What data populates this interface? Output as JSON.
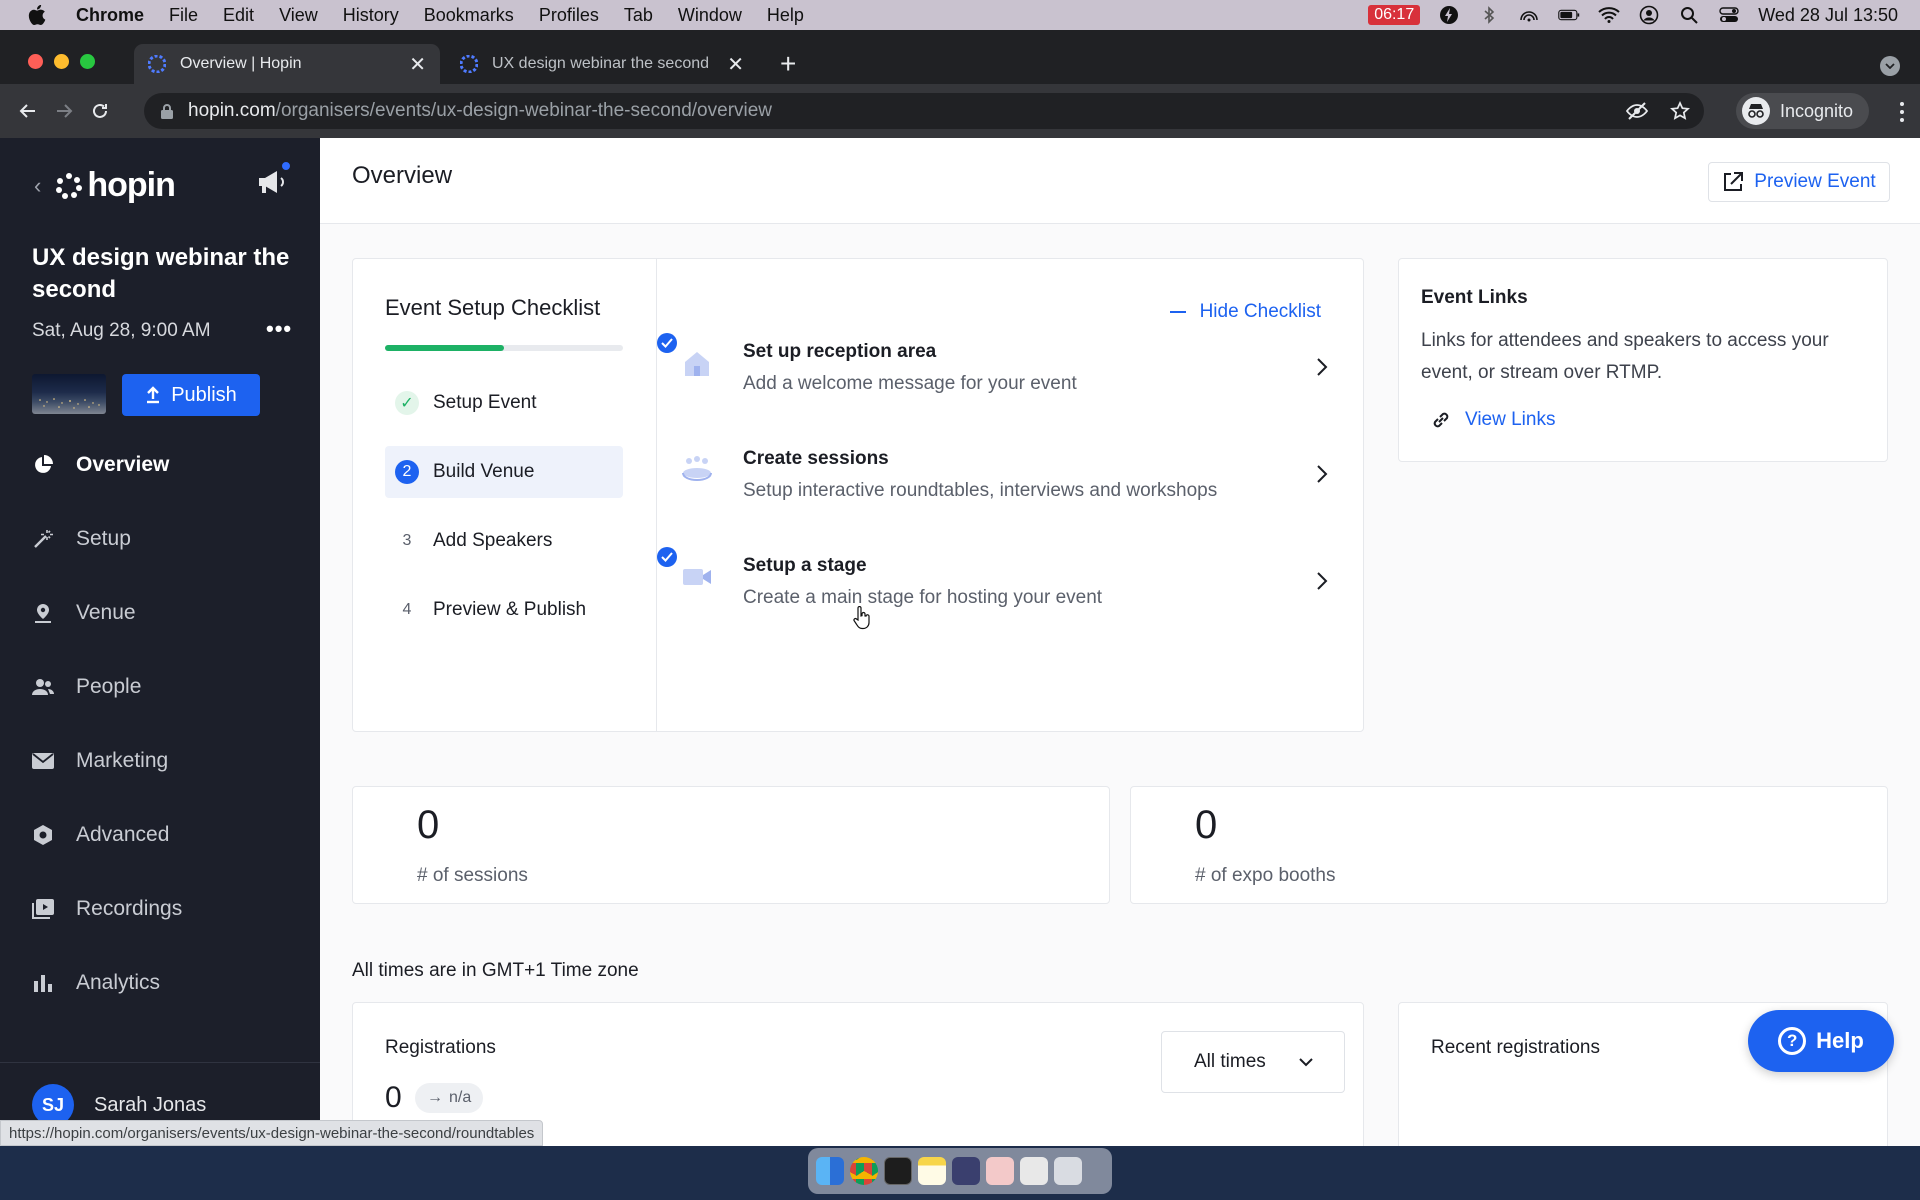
{
  "menubar": {
    "app": "Chrome",
    "items": [
      "File",
      "Edit",
      "View",
      "History",
      "Bookmarks",
      "Profiles",
      "Tab",
      "Window",
      "Help"
    ],
    "battery_time": "06:17",
    "datetime": "Wed 28 Jul  13:50"
  },
  "browser": {
    "tabs": [
      {
        "title": "Overview | Hopin"
      },
      {
        "title": "UX design webinar the second"
      }
    ],
    "url_host": "hopin.com",
    "url_path": "/organisers/events/ux-design-webinar-the-second/overview",
    "profile": "Incognito",
    "status_url": "https://hopin.com/organisers/events/ux-design-webinar-the-second/roundtables"
  },
  "sidebar": {
    "logo": "hopin",
    "event_title": "UX design webinar the second",
    "event_date": "Sat, Aug 28, 9:00 AM",
    "more": "•••",
    "publish_label": "Publish",
    "nav": [
      {
        "label": "Overview",
        "icon": "pie-chart-icon"
      },
      {
        "label": "Setup",
        "icon": "magic-wand-icon"
      },
      {
        "label": "Venue",
        "icon": "venue-pin-icon"
      },
      {
        "label": "People",
        "icon": "people-icon"
      },
      {
        "label": "Marketing",
        "icon": "envelope-icon"
      },
      {
        "label": "Advanced",
        "icon": "hexagon-gear-icon"
      },
      {
        "label": "Recordings",
        "icon": "recordings-icon"
      },
      {
        "label": "Analytics",
        "icon": "bar-chart-icon"
      }
    ],
    "user": {
      "initials": "SJ",
      "name": "Sarah Jonas"
    }
  },
  "header": {
    "title": "Overview",
    "preview_label": "Preview Event"
  },
  "checklist": {
    "title": "Event Setup Checklist",
    "progress": 0.5,
    "hide_label": "Hide Checklist",
    "steps": [
      {
        "num": "✓",
        "label": "Setup Event",
        "state": "done"
      },
      {
        "num": "2",
        "label": "Build Venue",
        "state": "current"
      },
      {
        "num": "3",
        "label": "Add Speakers",
        "state": "todo"
      },
      {
        "num": "4",
        "label": "Preview & Publish",
        "state": "todo"
      }
    ],
    "tasks": [
      {
        "title": "Set up reception area",
        "desc": "Add a welcome message for your event",
        "done": true
      },
      {
        "title": "Create sessions",
        "desc": "Setup interactive roundtables, interviews and workshops",
        "done": false
      },
      {
        "title": "Setup a stage",
        "desc": "Create a main stage for hosting your event",
        "done": true
      }
    ]
  },
  "event_links": {
    "title": "Event Links",
    "desc": "Links for attendees and speakers to access your event, or stream over RTMP.",
    "link_label": "View Links"
  },
  "stats": [
    {
      "value": "0",
      "label": "# of sessions"
    },
    {
      "value": "0",
      "label": "# of expo booths"
    }
  ],
  "timezone_note": "All times are in GMT+1 Time zone",
  "registrations": {
    "title": "Registrations",
    "value": "0",
    "change": "n/a",
    "range_label": "All times"
  },
  "recent": {
    "title": "Recent registrations"
  },
  "help_label": "Help"
}
